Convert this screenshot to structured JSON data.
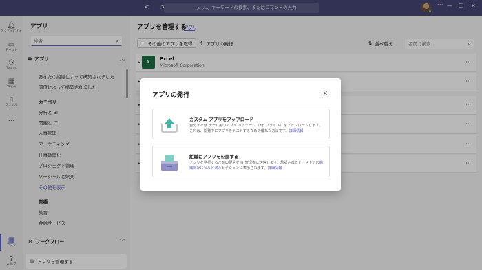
{
  "titlebar": {
    "search_placeholder": "人、キーワードの検索、またはコマンドの入力"
  },
  "rail": {
    "items": [
      {
        "label": "アクティビティ",
        "icon": "bell-icon"
      },
      {
        "label": "チャット",
        "icon": "chat-icon"
      },
      {
        "label": "Teams",
        "icon": "teams-icon"
      },
      {
        "label": "予定表",
        "icon": "calendar-icon"
      },
      {
        "label": "ファイル",
        "icon": "file-icon"
      },
      {
        "label": "アプリ",
        "icon": "apps-icon"
      },
      {
        "label": "ヘルプ",
        "icon": "help-icon"
      }
    ]
  },
  "sidebar": {
    "title": "アプリ",
    "search_placeholder": "検索",
    "section_apps": "アプリ",
    "links_top": [
      "あなたの組織によって構築されました",
      "同僚によって構築されました"
    ],
    "category_heading": "カテゴリ",
    "categories": [
      "分析と BI",
      "開発と IT",
      "人事管理",
      "マーケティング",
      "仕事効率化",
      "プロジェクト管理",
      "ソーシャルと娯楽"
    ],
    "show_more": "その他を表示",
    "industry_heading": "業種",
    "industries": [
      "教育",
      "金融サービス"
    ],
    "workflow": "ワークフロー",
    "manage": "アプリを管理する"
  },
  "main": {
    "title": "アプリを管理する",
    "tab": "アプリ",
    "toolbar": {
      "get_more": "その他のアプリを取得",
      "publish": "アプリの発行",
      "sort": "並べ替え",
      "search_placeholder": "名前で検索"
    },
    "apps": [
      {
        "name": "Excel",
        "publisher": "Microsoft Corporation",
        "icon_text": "X"
      }
    ]
  },
  "dialog": {
    "title": "アプリの発行",
    "options": [
      {
        "title": "カスタム アプリをアップロード",
        "desc": "自分または チーム用のアプリ パッケージ（zip ファイル）をアップロードします。これは、開発中にアプリをテストするための優れた方法です。",
        "link": "詳細情報",
        "icon": "upload-icon"
      },
      {
        "title": "組織にアプリを公開する",
        "desc": "アプリを発行するための要求を IT 管理者に送信します。承認されると、ストアの",
        "desc_link": "組織向けにビルド済み",
        "desc_tail": "セクションに表示されます。",
        "link": "詳細情報",
        "icon": "publish-icon"
      }
    ]
  },
  "colors": {
    "accent": "#5b5fc7",
    "titlebar": "#464775",
    "excel": "#1d6f42"
  }
}
